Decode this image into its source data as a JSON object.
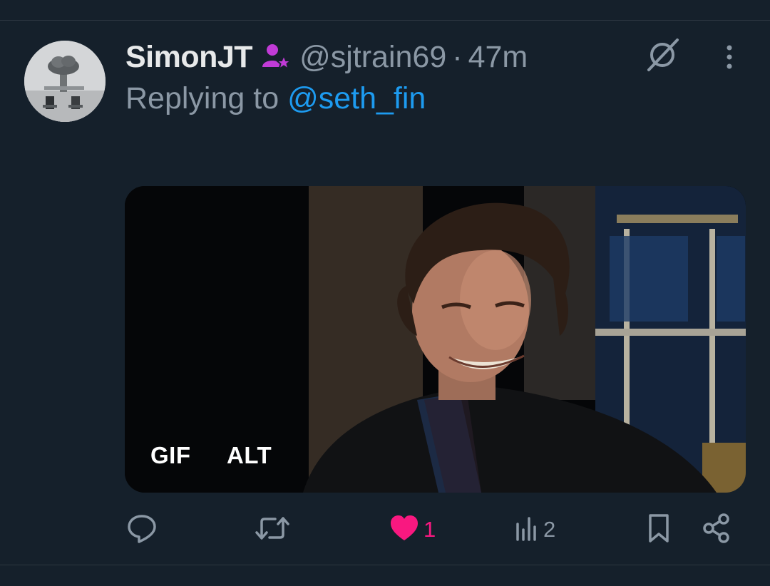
{
  "tweet": {
    "display_name": "SimonJT",
    "handle": "@sjtrain69",
    "separator": "·",
    "time": "47m",
    "replying_prefix": "Replying to ",
    "replying_to": "@seth_fin"
  },
  "media": {
    "gif_label": "GIF",
    "alt_label": "ALT"
  },
  "actions": {
    "like_count": "1",
    "views_count": "2"
  },
  "icons": {
    "badge": "subscriber-badge-icon",
    "grok": "grok-icon",
    "more": "more-icon",
    "reply": "reply-icon",
    "retweet": "retweet-icon",
    "like": "heart-icon",
    "views": "views-icon",
    "bookmark": "bookmark-icon",
    "share": "share-icon"
  },
  "colors": {
    "background": "#15202b",
    "primary_text": "#e7e9ea",
    "secondary_text": "#8b98a5",
    "link": "#1d9bf0",
    "like": "#f91880",
    "badge": "#c13bd7"
  }
}
